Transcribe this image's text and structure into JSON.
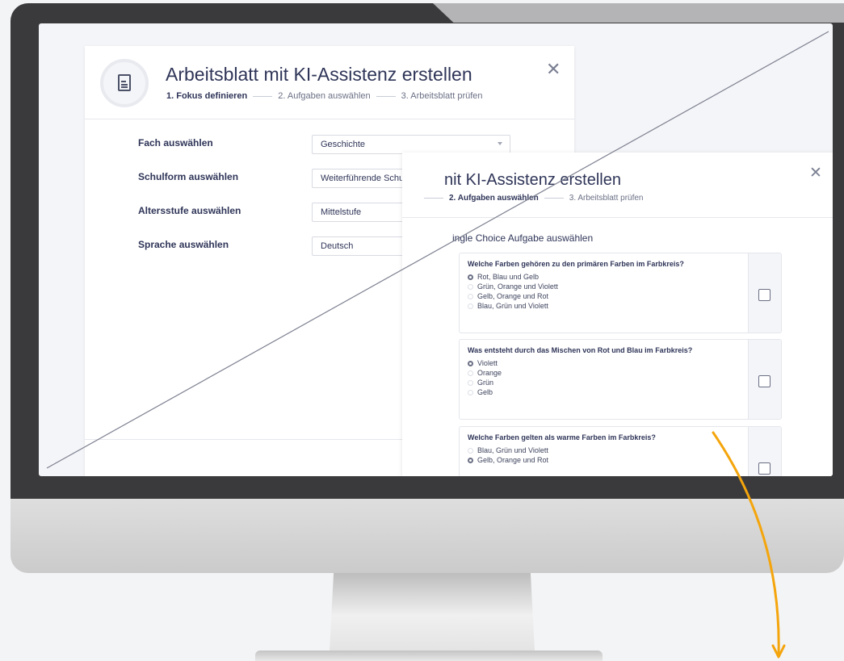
{
  "colors": {
    "primary_text": "#2f3558",
    "accent_arrow": "#f4a50c",
    "bezel": "#3a3a3c"
  },
  "dialog_step1": {
    "title": "Arbeitsblatt mit KI-Assistenz erstellen",
    "steps": [
      "1. Fokus definieren",
      "2. Aufgaben auswählen",
      "3. Arbeitsblatt prüfen"
    ],
    "fields": [
      {
        "label": "Fach auswählen",
        "value": "Geschichte"
      },
      {
        "label": "Schulform auswählen",
        "value": "Weiterführende Schule"
      },
      {
        "label": "Altersstufe auswählen",
        "value": "Mittelstufe"
      },
      {
        "label": "Sprache auswählen",
        "value": "Deutsch"
      }
    ]
  },
  "dialog_step2": {
    "title": "nit KI-Assistenz erstellen",
    "steps": [
      "2. Aufgaben auswählen",
      "3. Arbeitsblatt prüfen"
    ],
    "section_title": "ingle Choice Aufgabe auswählen",
    "questions": [
      {
        "text": "Welche Farben gehören zu den primären Farben im Farbkreis?",
        "options": [
          "Rot, Blau und Gelb",
          "Grün, Orange und Violett",
          "Gelb, Orange und Rot",
          "Blau, Grün und Violett"
        ],
        "selected": 0
      },
      {
        "text": "Was entsteht durch das Mischen von Rot und Blau im Farbkreis?",
        "options": [
          "Violett",
          "Orange",
          "Grün",
          "Gelb"
        ],
        "selected": 0
      },
      {
        "text": "Welche Farben gelten als warme Farben im Farbkreis?",
        "options": [
          "Blau, Grün und Violett",
          "Gelb, Orange und Rot"
        ],
        "selected": 1
      }
    ]
  }
}
